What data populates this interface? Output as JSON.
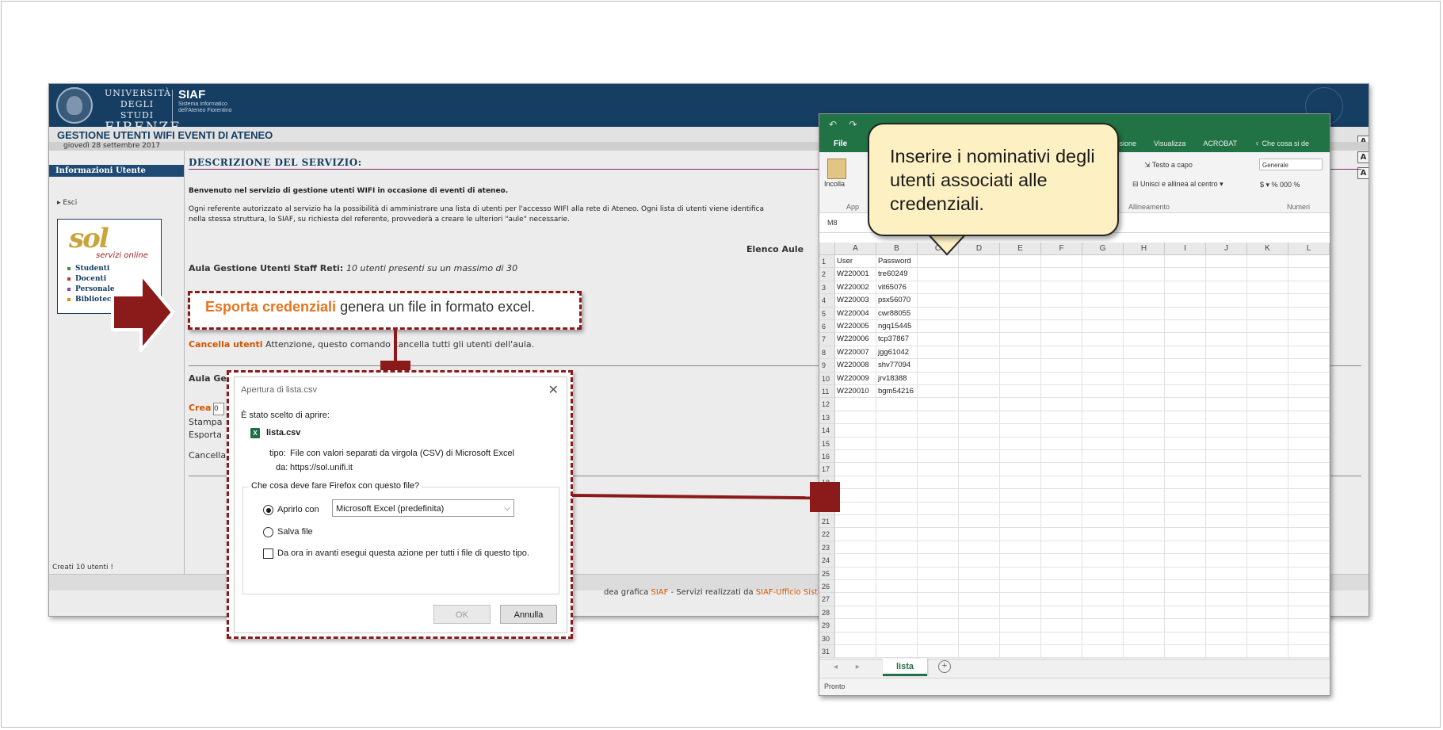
{
  "page": {
    "uni_line1": "UNIVERSITÀ",
    "uni_line2": "DEGLI STUDI",
    "uni_line3": "FIRENZE",
    "siaf_title": "SIAF",
    "siaf_subtitle": "Sistema Informatico dell'Ateneo Fiorentino",
    "title": "GESTIONE UTENTI WIFI EVENTI DI ATENEO",
    "date": "giovedì 28 settembre 2017",
    "font_sizes": [
      "A",
      "A",
      "A"
    ]
  },
  "sidebar": {
    "heading": "Informazioni Utente",
    "esci": "Esci",
    "sol_logo": "sol",
    "sol_subtitle": "servizi online",
    "sol_links": [
      "Studenti",
      "Docenti",
      "Personale",
      "Biblioteche"
    ],
    "status": "Creati 10 utenti !"
  },
  "main": {
    "desc_heading": "DESCRIZIONE DEL SERVIZIO:",
    "welcome": "Benvenuto nel servizio di gestione utenti WIFI in occasione di eventi di ateneo.",
    "desc_text_1": "Ogni referente autorizzato al servizio ha la possibilità di amministrare una lista di utenti per l'accesso WIFI alla rete di Ateneo. Ogni lista di utenti viene identifica",
    "desc_text_2": "nella stessa struttura, lo SIAF, su richiesta del referente, provvederà a creare le ulteriori \"aule\" necessarie.",
    "elenco_aule": "Elenco Aule",
    "aula1_name": "Aula Gestione Utenti Staff Reti:",
    "aula1_info": "10 utenti presenti su un massimo di 30",
    "cancella_link": "Cancella utenti",
    "cancella_text": "Attenzione, questo comando cancella tutti gli utenti dell'aula.",
    "aula2_name": "Aula Ges",
    "crea_label": "Crea",
    "crea_value": "0",
    "stampa_label": "Stampa",
    "esporta_label": "Esporta",
    "cancella2_label": "Cancella",
    "footer_mid": "dea grafica ",
    "footer_siaf": "SIAF",
    "footer_after": " - Servizi realizzati da ",
    "footer_ufficio": "SIAF-Ufficio Sistemi Inf"
  },
  "callout": {
    "highlight": "Esporta credenziali",
    "text": " genera un file in formato excel."
  },
  "dialog": {
    "title": "Apertura di lista.csv",
    "close": "✕",
    "chosen": "È stato scelto di aprire:",
    "file_icon": "X",
    "filename": "lista.csv",
    "tipo_label": "tipo:",
    "tipo_value": "File con valori separati da virgola (CSV) di Microsoft Excel",
    "da_label": "da:",
    "da_value": "https://sol.unifi.it",
    "question": "Che cosa deve fare Firefox con questo file?",
    "open_with": "Aprirlo con",
    "app": "Microsoft Excel (predefinita)",
    "save": "Salva file",
    "remember": "Da ora in avanti esegui questa azione per tutti i file di questo tipo.",
    "ok": "OK",
    "cancel": "Annulla",
    "open_selected": true
  },
  "excel": {
    "file_tab": "File",
    "tabs": [
      "visione",
      "Visualizza",
      "ACROBAT",
      "♀ Che cosa si de"
    ],
    "incolla": "Incolla",
    "appunti": "App",
    "testo_a_capo": "Testo a capo",
    "unisci": "Unisci e allinea al centro",
    "allineamento": "Allineamento",
    "formato": "Generale",
    "numeri": "Numeri",
    "name_box": "M8",
    "columns": [
      "A",
      "B",
      "C",
      "D",
      "E",
      "F",
      "G",
      "H",
      "I",
      "J",
      "K",
      "L"
    ],
    "header_row": [
      "User",
      "Password"
    ],
    "rows": [
      [
        "W220001",
        "tre60249"
      ],
      [
        "W220002",
        "vit65076"
      ],
      [
        "W220003",
        "psx56070"
      ],
      [
        "W220004",
        "cwr88055"
      ],
      [
        "W220005",
        "ngq15445"
      ],
      [
        "W220006",
        "tcp37867"
      ],
      [
        "W220007",
        "jgg61042"
      ],
      [
        "W220008",
        "shv77094"
      ],
      [
        "W220009",
        "jrv18388"
      ],
      [
        "W220010",
        "bgm54216"
      ]
    ],
    "row_count": 31,
    "sheet_tab": "lista",
    "status": "Pronto",
    "accent": "#217346"
  },
  "bubble": {
    "text": "Inserire i nominativi degli utenti associati alle credenziali."
  },
  "colors": {
    "banner": "#163e63",
    "callout_dark_red": "#8b1a1a",
    "highlight_orange": "#e8741e",
    "bubble_fill": "#fdf1c4"
  }
}
